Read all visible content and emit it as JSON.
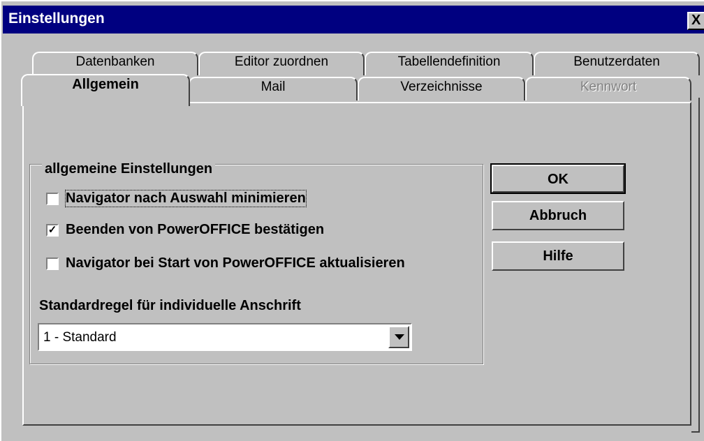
{
  "window": {
    "title": "Einstellungen",
    "close_glyph": "X"
  },
  "tabs_row1": [
    {
      "label": "Datenbanken"
    },
    {
      "label": "Editor zuordnen"
    },
    {
      "label": "Tabellendefinition"
    },
    {
      "label": "Benutzerdaten"
    }
  ],
  "tabs_row2": [
    {
      "label": "Allgemein",
      "active": true
    },
    {
      "label": "Mail"
    },
    {
      "label": "Verzeichnisse"
    },
    {
      "label": "Kennwort",
      "disabled": true
    }
  ],
  "group": {
    "title": "allgemeine Einstellungen",
    "checkboxes": [
      {
        "label": "Navigator nach Auswahl minimieren",
        "checked": false
      },
      {
        "label": "Beenden von PowerOFFICE bestätigen",
        "checked": true
      },
      {
        "label": "Navigator bei Start von PowerOFFICE aktualisieren",
        "checked": false
      }
    ],
    "dropdown_label": "Standardregel für individuelle Anschrift",
    "dropdown_value": "1 - Standard"
  },
  "buttons": {
    "ok": "OK",
    "cancel": "Abbruch",
    "help": "Hilfe"
  }
}
